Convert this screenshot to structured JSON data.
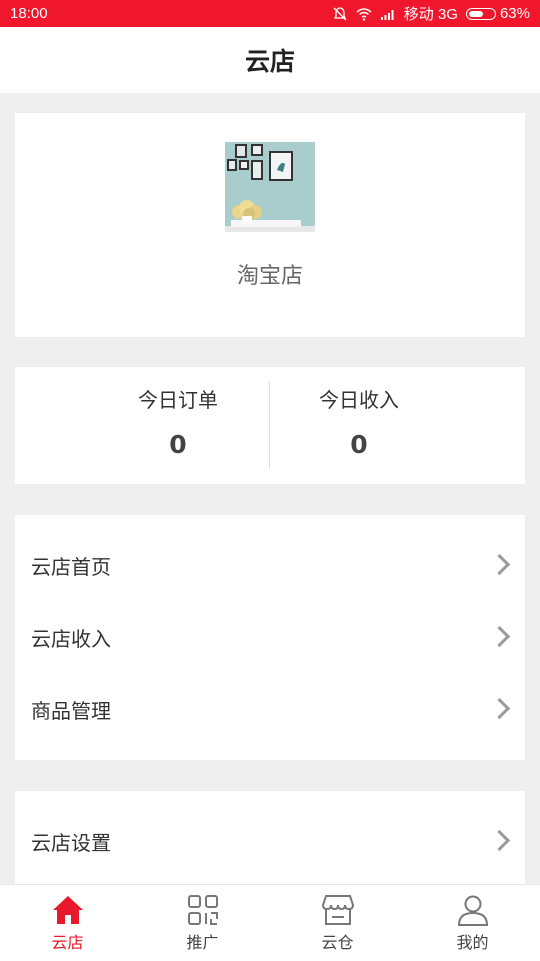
{
  "status_bar": {
    "time": "18:00",
    "carrier": "移动 3G",
    "battery_percent": "63%",
    "battery_level": 0.63
  },
  "header": {
    "title": "云店"
  },
  "shop": {
    "name": "淘宝店"
  },
  "stats": {
    "today_orders_label": "今日订单",
    "today_orders_value": "0",
    "today_income_label": "今日收入",
    "today_income_value": "0"
  },
  "menu": {
    "items": [
      {
        "label": "云店首页"
      },
      {
        "label": "云店收入"
      },
      {
        "label": "商品管理"
      }
    ],
    "items2": [
      {
        "label": "云店设置"
      }
    ]
  },
  "tabbar": {
    "tabs": [
      {
        "label": "云店",
        "icon": "home-icon",
        "active": true
      },
      {
        "label": "推广",
        "icon": "qr-code-icon",
        "active": false
      },
      {
        "label": "云仓",
        "icon": "store-icon",
        "active": false
      },
      {
        "label": "我的",
        "icon": "user-icon",
        "active": false
      }
    ]
  },
  "colors": {
    "accent": "#f0162b",
    "background": "#efefef"
  }
}
